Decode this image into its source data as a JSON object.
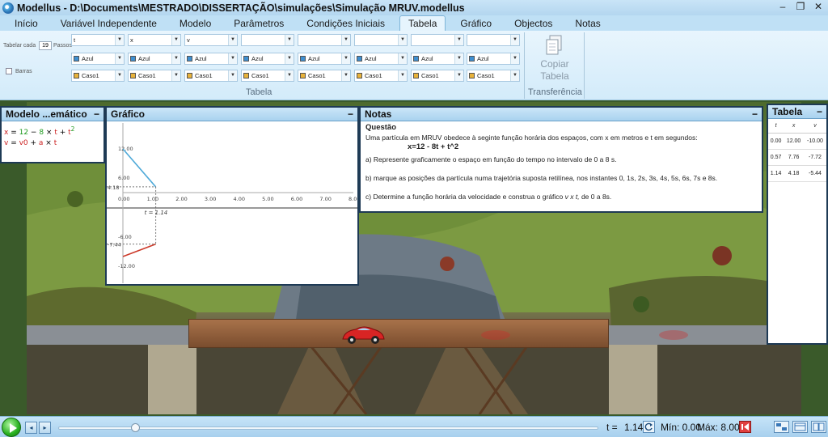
{
  "window": {
    "title": "Modellus - D:\\Documents\\MESTRADO\\DISSERTAÇÃO\\simulações\\Simulação MRUV.modellus",
    "controls": [
      "–",
      "❐",
      "✕"
    ]
  },
  "tabs": [
    "Início",
    "Variável Independente",
    "Modelo",
    "Parâmetros",
    "Condições Iniciais",
    "Tabela",
    "Gráfico",
    "Objectos",
    "Notas"
  ],
  "active_tab": "Tabela",
  "ribbon": {
    "tabelar_label": "Tabelar cada",
    "tabelar_value": "19",
    "passos_label": "Passos",
    "barras_label": "Barras",
    "columns": [
      {
        "var": "t",
        "color": "Azul",
        "case": "Caso1"
      },
      {
        "var": "x",
        "color": "Azul",
        "case": "Caso1"
      },
      {
        "var": "v",
        "color": "Azul",
        "case": "Caso1"
      },
      {
        "var": "",
        "color": "Azul",
        "case": "Caso1"
      },
      {
        "var": "",
        "color": "Azul",
        "case": "Caso1"
      },
      {
        "var": "",
        "color": "Azul",
        "case": "Caso1"
      },
      {
        "var": "",
        "color": "Azul",
        "case": "Caso1"
      },
      {
        "var": "",
        "color": "Azul",
        "case": "Caso1"
      }
    ],
    "group_tabela": "Tabela",
    "copy_label_1": "Copiar",
    "copy_label_2": "Tabela",
    "group_transferencia": "Transferência",
    "colors": {
      "azul": "#3f8fd0",
      "caso": "#e8b23a"
    }
  },
  "model_panel": {
    "title": "Modelo ...emático",
    "min": "−",
    "eq1": {
      "lhs": "x",
      "eq": " = ",
      "c1": "12",
      "op1": " − ",
      "c2": "8",
      "op2": " × ",
      "t1": "t",
      "op3": " + ",
      "t2": "t",
      "exp": "2"
    },
    "eq2": {
      "lhs": "v",
      "eq": " = ",
      "t1": "v0",
      "op1": " + ",
      "t2": "a",
      "op2": " × ",
      "t3": "t"
    }
  },
  "graph_panel": {
    "title": "Gráfico",
    "min": "−",
    "cursor_label": "t = 1.14",
    "left_label_top": "4.18",
    "left_label_bottom": "-7.44"
  },
  "chart_data": [
    {
      "type": "line",
      "x": [
        0,
        1.14
      ],
      "series": [
        {
          "values": [
            12.0,
            4.18
          ]
        }
      ],
      "xlim": [
        0,
        8
      ],
      "xticks": [
        "0.00",
        "1.00",
        "2.00",
        "3.00",
        "4.00",
        "5.00",
        "6.00",
        "7.00",
        "8.00"
      ],
      "yticks": [
        "12.00",
        "6.00"
      ],
      "ylim": [
        0,
        14
      ],
      "color": "#4ea9d8"
    },
    {
      "type": "line",
      "x": [
        0,
        1.14
      ],
      "series": [
        {
          "values": [
            -10.0,
            -7.44
          ]
        }
      ],
      "xlim": [
        0,
        8
      ],
      "yticks": [
        "-6.00",
        "-12.00"
      ],
      "ylim": [
        -14,
        -3
      ],
      "color": "#cc3a2a"
    }
  ],
  "notes_panel": {
    "title": "Notas",
    "min": "−",
    "heading": "Questão",
    "intro": "Uma partícula em MRUV obedece à seginte função horária dos espaços, com x em metros e t em segundos:",
    "formula": "x=12 - 8t + t^2",
    "item_a": "a) Represente graficamente o espaço em função do tempo no intervalo de 0 a 8 s.",
    "item_b": "b) marque as posições da partícula numa trajetória suposta retilínea, nos instantes 0, 1s, 2s, 3s, 4s, 5s, 6s, 7s e 8s.",
    "item_c_pre": "c) Determine a função horária da velocidade e construa o gráfico ",
    "item_c_var": "v x t,",
    "item_c_post": " de 0 a 8s."
  },
  "table_panel": {
    "title": "Tabela",
    "min": "−",
    "headers": [
      "t",
      "x",
      "v"
    ],
    "rows": [
      [
        "0.00",
        "12.00",
        "-10.00"
      ],
      [
        "0.57",
        "7.76",
        "-7.72"
      ],
      [
        "1.14",
        "4.18",
        "-5.44"
      ]
    ]
  },
  "bottom": {
    "t_label": "t =",
    "t_value": "1.14",
    "min_label": "Mín: 0.00",
    "max_label": "Máx: 8.00",
    "progress": 0.1425,
    "step_back": "◂",
    "step_fwd": "▸"
  }
}
